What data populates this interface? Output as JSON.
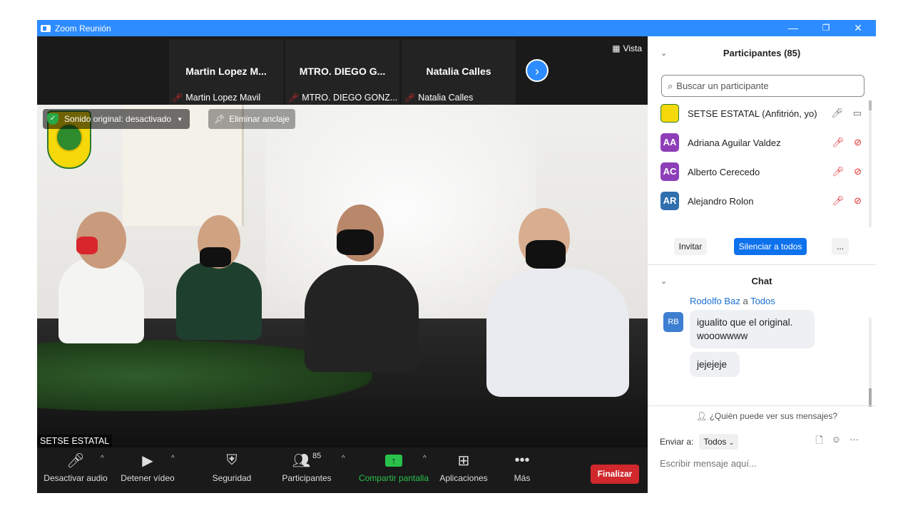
{
  "window": {
    "title": "Zoom Reunión",
    "minimize": "—",
    "restore": "❐",
    "close": "✕"
  },
  "thumbs": [
    {
      "display_name": "Martin  Lopez M...",
      "footer": "Martin Lopez Mavil"
    },
    {
      "display_name": "MTRO. DIEGO G...",
      "footer": "MTRO. DIEGO GONZ..."
    },
    {
      "display_name": "Natalia Calles",
      "footer": "Natalia Calles"
    }
  ],
  "view_button": "Vista",
  "main_video": {
    "sound_original": "Sonido original: desactivado",
    "unpin": "Eliminar anclaje",
    "speaker": "SETSE ESTATAL"
  },
  "toolbar": {
    "mute": "Desactivar audio",
    "video": "Detener vídeo",
    "security": "Seguridad",
    "participants": "Participantes",
    "participants_count": "85",
    "share": "Compartir pantalla",
    "apps": "Aplicaciones",
    "more": "Más",
    "end": "Finalizar"
  },
  "participants_panel": {
    "title": "Participantes (85)",
    "search_placeholder": "Buscar un participante",
    "items": [
      {
        "name": "SETSE ESTATAL (Anfitrión, yo)",
        "initials": "",
        "color": "#f5d90a"
      },
      {
        "name": "Adriana Aguilar Valdez",
        "initials": "AA",
        "color": "#8e3fb8"
      },
      {
        "name": "Alberto Cerecedo",
        "initials": "AC",
        "color": "#8e3fb8"
      },
      {
        "name": "Alejandro Rolon",
        "initials": "AR",
        "color": "#2f6fae"
      }
    ],
    "invite": "Invitar",
    "mute_all": "Silenciar a todos",
    "more": "..."
  },
  "chat": {
    "title": "Chat",
    "sender": "Rodolfo Baz",
    "sep": "a",
    "recipient": "Todos",
    "sender_initials": "RB",
    "messages": [
      "igualito que el original.\nwooowwww",
      "jejejeje"
    ],
    "who_can_see": "¿Quién puede ver sus mensajes?",
    "send_to_label": "Enviar a:",
    "send_to_value": "Todos",
    "input_placeholder": "Escribir mensaje aquí..."
  },
  "colors": {
    "zoom_blue": "#2D8CFF",
    "end_red": "#d0282c",
    "share_green": "#29c14a"
  }
}
